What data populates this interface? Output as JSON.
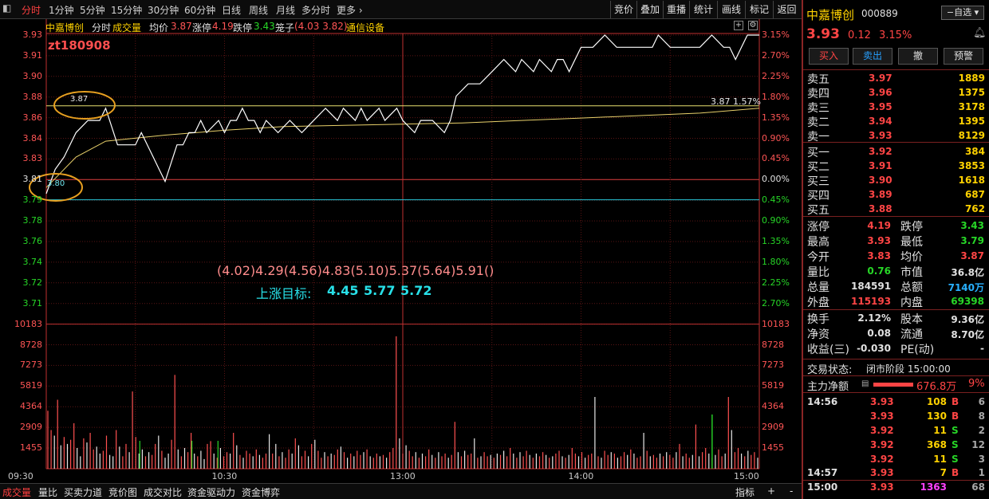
{
  "topbar": {
    "left_tabs": [
      "分时",
      "1分钟",
      "5分钟",
      "15分钟",
      "30分钟",
      "60分钟",
      "日线",
      "周线",
      "月线",
      "多分时",
      "更多"
    ],
    "right_tabs": [
      "竞价",
      "叠加",
      "重播",
      "统计",
      "画线",
      "标记",
      "返回"
    ]
  },
  "info": {
    "stock_name": "中嘉博创",
    "mode": "分时",
    "volume_label": "成交量",
    "avg_label": "均价",
    "avg_value": "3.87",
    "limit_up_label": "涨停",
    "limit_up_value": "4.19",
    "limit_down_label": "跌停",
    "limit_down_value": "3.43",
    "chip_label": "笼子",
    "chip_value": "(4.03 3.82)",
    "sector": "通信设备"
  },
  "chart": {
    "watermark": "zt180908",
    "circle_high_label": "3.87",
    "circle_low_label": "3.80",
    "line_label": "3.87 1.57%",
    "targets_text": "(4.02)4.29(4.56)4.83(5.10)5.37(5.64)5.91()",
    "target_title": "上涨目标:",
    "target_values": [
      "4.45",
      "5.77",
      "5.72"
    ],
    "colors": {
      "price_line": "#ffffff",
      "avg_line": "#e8d06a",
      "up": "#ff5050",
      "down": "#27d627"
    }
  },
  "chart_data": {
    "type": "line",
    "title": "",
    "price_ticks_left": [
      "3.93",
      "3.91",
      "3.90",
      "3.88",
      "3.86",
      "3.84",
      "3.83",
      "3.81",
      "3.79",
      "3.78",
      "3.76",
      "3.74",
      "3.72",
      "3.71"
    ],
    "pct_ticks_right": [
      "3.15%",
      "2.70%",
      "2.25%",
      "1.80%",
      "1.35%",
      "0.90%",
      "0.45%",
      "0.00%",
      "0.45%",
      "0.90%",
      "1.35%",
      "1.80%",
      "2.25%",
      "2.70%"
    ],
    "volume_ticks": [
      "10183",
      "8728",
      "7273",
      "5819",
      "4364",
      "2909",
      "1455"
    ],
    "x_ticks": [
      "09:30",
      "10:30",
      "13:00",
      "14:00",
      "15:00"
    ],
    "ylim": [
      3.7,
      3.94
    ],
    "prev_close": 3.81,
    "series": [
      {
        "name": "分时",
        "x": [
          0,
          3,
          6,
          10,
          14,
          18,
          20,
          24,
          30,
          32,
          36,
          38,
          40,
          44,
          46,
          48,
          50,
          52,
          54,
          58,
          60,
          62,
          64,
          66,
          68,
          70,
          72,
          74,
          78,
          82,
          86,
          90,
          94,
          98,
          100,
          104,
          106,
          108,
          112,
          114,
          118,
          120,
          124,
          126,
          130,
          134,
          136,
          138,
          142,
          146,
          150,
          154,
          158,
          160,
          164,
          166,
          170,
          172,
          174,
          176,
          180,
          184,
          188,
          192,
          196,
          200,
          204,
          206,
          210,
          214,
          218,
          220,
          224,
          228,
          230,
          232,
          234,
          236,
          240
        ],
        "y": [
          3.8,
          3.82,
          3.83,
          3.85,
          3.86,
          3.86,
          3.87,
          3.84,
          3.84,
          3.85,
          3.83,
          3.82,
          3.81,
          3.84,
          3.84,
          3.85,
          3.85,
          3.86,
          3.85,
          3.86,
          3.85,
          3.86,
          3.86,
          3.87,
          3.86,
          3.86,
          3.85,
          3.86,
          3.85,
          3.86,
          3.85,
          3.86,
          3.87,
          3.86,
          3.87,
          3.86,
          3.87,
          3.86,
          3.87,
          3.86,
          3.87,
          3.86,
          3.85,
          3.86,
          3.86,
          3.85,
          3.86,
          3.88,
          3.89,
          3.89,
          3.9,
          3.91,
          3.9,
          3.91,
          3.9,
          3.91,
          3.9,
          3.91,
          3.91,
          3.9,
          3.92,
          3.92,
          3.93,
          3.92,
          3.92,
          3.92,
          3.92,
          3.93,
          3.92,
          3.92,
          3.92,
          3.92,
          3.93,
          3.92,
          3.92,
          3.91,
          3.92,
          3.93,
          3.93
        ]
      },
      {
        "name": "均价",
        "x": [
          0,
          10,
          20,
          40,
          60,
          80,
          100,
          120,
          140,
          160,
          180,
          200,
          220,
          240
        ],
        "y": [
          3.805,
          3.83,
          3.843,
          3.848,
          3.852,
          3.855,
          3.856,
          3.857,
          3.858,
          3.86,
          3.862,
          3.864,
          3.866,
          3.87
        ]
      }
    ],
    "volume": [
      4200,
      2800,
      2400,
      5000,
      1700,
      2300,
      1800,
      2100,
      3300,
      1500,
      900,
      2200,
      1900,
      2600,
      1400,
      1600,
      1100,
      1300,
      2400,
      1000,
      900,
      2800,
      1600,
      900,
      1800,
      1200,
      5600,
      2300,
      1100,
      1400,
      900,
      1200,
      1000,
      1800,
      2400,
      1300,
      800,
      1100,
      2100,
      6800,
      1400,
      900,
      1500,
      1200,
      2600,
      1100,
      900,
      1300,
      700,
      1800,
      2000,
      1100,
      800,
      1500,
      900,
      1200,
      1100,
      2600,
      1700,
      1000,
      800,
      1300,
      1100,
      900,
      1400,
      1000,
      800,
      1100,
      2500,
      1100,
      1800,
      900,
      1200,
      800,
      1400,
      1100,
      2200,
      1700,
      900,
      1300,
      900,
      1800,
      2100,
      1300,
      800,
      1200,
      900,
      1100,
      1000,
      1400,
      1600,
      1200,
      800,
      1100,
      900,
      1300,
      1000,
      1200,
      1400,
      900,
      800,
      1100,
      900,
      1000,
      800,
      1200,
      1500,
      9600,
      2200,
      1100,
      1700,
      1300,
      900,
      1200,
      800,
      1100,
      900,
      1400,
      1000,
      800,
      1200,
      900,
      1100,
      800,
      1000,
      3400,
      1200,
      900,
      1300,
      1000,
      1100,
      2200,
      800,
      900,
      1200,
      900,
      1000,
      800,
      1100,
      1000,
      1300,
      900,
      1500,
      1100,
      800,
      1200,
      900,
      1300,
      1000,
      800,
      1100,
      900,
      1200,
      1000,
      800,
      900,
      1100,
      1300,
      900,
      800,
      1000,
      1500,
      1100,
      900,
      1200,
      800,
      1000,
      1100,
      5200,
      900,
      800,
      1300,
      1000,
      1200,
      1100,
      800,
      900,
      1200,
      1000,
      1400,
      1100,
      800,
      900,
      2600,
      1300,
      900,
      1000,
      800,
      1100,
      900,
      1200,
      1000,
      800,
      1200,
      1800,
      900,
      1100,
      800,
      1000,
      3200,
      900,
      1200,
      1500,
      1100,
      800,
      1000,
      1400,
      900,
      1100,
      5200,
      2800,
      1200,
      1500,
      1100,
      900,
      1300,
      1000,
      1200,
      800
    ],
    "volume_up": [
      1,
      1,
      0,
      1,
      0,
      1,
      0,
      1,
      1,
      0,
      0,
      1,
      0,
      1,
      1,
      0,
      0,
      1,
      1,
      0,
      0,
      1,
      0,
      1,
      1,
      0,
      1,
      1,
      0,
      0,
      1,
      0,
      1,
      1,
      0,
      1,
      0,
      0,
      1,
      1,
      0,
      1,
      0,
      1,
      1,
      0,
      1,
      0,
      0,
      1,
      1,
      0,
      1,
      0,
      1,
      1,
      0,
      1,
      0,
      1,
      0,
      1,
      1,
      0,
      1,
      0,
      1,
      1,
      0,
      1,
      0,
      1,
      0,
      1,
      1,
      0,
      1,
      0,
      1,
      1,
      0,
      1,
      0,
      1,
      1,
      0,
      1,
      0,
      1,
      1,
      0,
      1,
      0,
      1,
      0,
      1,
      1,
      0,
      1,
      0,
      1,
      1,
      0,
      1,
      0,
      1,
      1,
      1,
      0,
      1,
      0,
      1,
      1,
      0,
      1,
      0,
      1,
      1,
      0,
      1,
      0,
      1,
      1,
      0,
      1,
      1,
      0,
      1,
      0,
      1,
      1,
      0,
      1,
      0,
      1,
      1,
      0,
      1,
      0,
      1,
      0,
      1,
      1,
      0,
      1,
      0,
      1,
      1,
      0,
      1,
      0,
      1,
      1,
      0,
      1,
      0,
      1,
      1,
      0,
      1,
      0,
      1,
      1,
      0,
      1,
      0,
      1,
      1,
      0,
      1,
      0,
      1,
      1,
      0,
      1,
      0,
      1,
      1,
      0,
      1,
      0,
      1,
      1,
      0,
      1,
      0,
      1,
      1,
      0,
      1,
      0,
      1,
      1,
      0,
      1,
      0,
      1,
      1,
      0,
      1,
      0,
      1,
      1,
      0,
      1,
      0,
      1,
      1,
      0,
      1,
      0,
      1,
      1,
      0,
      1,
      0,
      1,
      1,
      0,
      1
    ]
  },
  "bottombar": {
    "tabs": [
      "成交量",
      "量比",
      "买卖力道",
      "竞价图",
      "成交对比",
      "资金驱动力",
      "资金博弈"
    ],
    "right": [
      "指标",
      "+",
      "-"
    ]
  },
  "panel": {
    "name": "中嘉博创",
    "code": "000889",
    "watch_btn": "自选",
    "price": "3.93",
    "change": "0.12",
    "change_pct": "3.15%",
    "buttons": [
      "买入",
      "卖出",
      "撤",
      "预警"
    ],
    "sells": [
      {
        "label": "卖五",
        "price": "3.97",
        "vol": "1889"
      },
      {
        "label": "卖四",
        "price": "3.96",
        "vol": "1375"
      },
      {
        "label": "卖三",
        "price": "3.95",
        "vol": "3178"
      },
      {
        "label": "卖二",
        "price": "3.94",
        "vol": "1395"
      },
      {
        "label": "卖一",
        "price": "3.93",
        "vol": "8129"
      }
    ],
    "buys": [
      {
        "label": "买一",
        "price": "3.92",
        "vol": "384"
      },
      {
        "label": "买二",
        "price": "3.91",
        "vol": "3853"
      },
      {
        "label": "买三",
        "price": "3.90",
        "vol": "1618"
      },
      {
        "label": "买四",
        "price": "3.89",
        "vol": "687"
      },
      {
        "label": "买五",
        "price": "3.88",
        "vol": "762"
      }
    ],
    "stats": [
      {
        "l1": "涨停",
        "v1": "4.19",
        "l2": "跌停",
        "v2": "3.43"
      },
      {
        "l1": "最高",
        "v1": "3.93",
        "l2": "最低",
        "v2": "3.79"
      },
      {
        "l1": "今开",
        "v1": "3.83",
        "l2": "均价",
        "v2": "3.87"
      },
      {
        "l1": "量比",
        "v1": "0.76",
        "l2": "市值",
        "v2": "36.8亿"
      },
      {
        "l1": "总量",
        "v1": "184591",
        "l2": "总额",
        "v2": "7140万"
      },
      {
        "l1": "外盘",
        "v1": "115193",
        "l2": "内盘",
        "v2": "69398"
      }
    ],
    "stats2": [
      {
        "l1": "换手",
        "v1": "2.12%",
        "l2": "股本",
        "v2": "9.36亿"
      },
      {
        "l1": "净资",
        "v1": "0.08",
        "l2": "流通",
        "v2": "8.70亿"
      },
      {
        "l1": "收益(三)",
        "v1": "-0.030",
        "l2": "PE(动)",
        "v2": "-"
      }
    ],
    "trade_status_label": "交易状态:",
    "trade_status": "闭市阶段 15:00:00",
    "netflow_label": "主力净额",
    "netflow_value": "676.8万",
    "netflow_pct": "9%",
    "ticks": [
      {
        "time": "14:56",
        "price": "3.93",
        "vol": "108",
        "side": "B",
        "n": "6"
      },
      {
        "time": "",
        "price": "3.93",
        "vol": "130",
        "side": "B",
        "n": "8"
      },
      {
        "time": "",
        "price": "3.92",
        "vol": "11",
        "side": "S",
        "n": "2"
      },
      {
        "time": "",
        "price": "3.92",
        "vol": "368",
        "side": "S",
        "n": "12"
      },
      {
        "time": "",
        "price": "3.92",
        "vol": "11",
        "side": "S",
        "n": "3"
      },
      {
        "time": "14:57",
        "price": "3.93",
        "vol": "7",
        "side": "B",
        "n": "1"
      },
      {
        "time": "15:00",
        "price": "3.93",
        "vol": "1363",
        "side": "",
        "n": "68"
      }
    ]
  }
}
